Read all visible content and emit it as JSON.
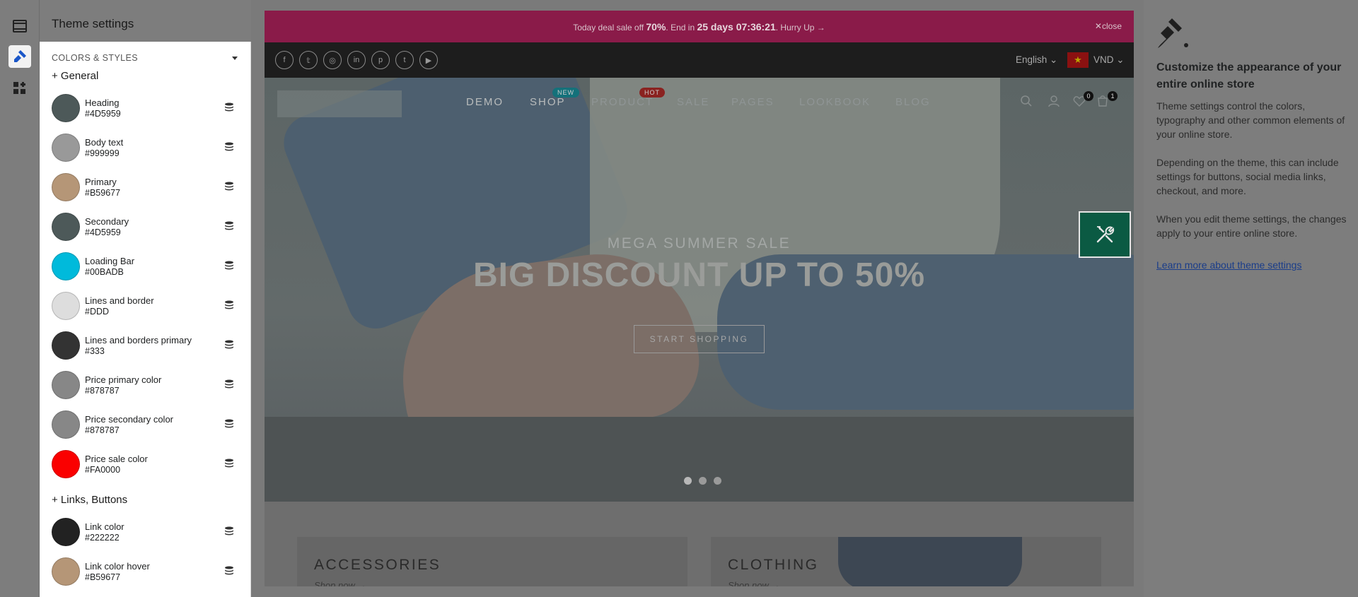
{
  "rail": {
    "items": [
      {
        "name": "sections-icon"
      },
      {
        "name": "theme-settings-icon",
        "active": true
      },
      {
        "name": "apps-icon"
      }
    ]
  },
  "settings": {
    "title": "Theme settings",
    "section_label": "COLORS & STYLES",
    "groups": [
      {
        "label": "+ General",
        "colors": [
          {
            "name": "Heading",
            "hex": "#4D5959",
            "color": "#4D5959"
          },
          {
            "name": "Body text",
            "hex": "#999999",
            "color": "#999999"
          },
          {
            "name": "Primary",
            "hex": "#B59677",
            "color": "#B59677"
          },
          {
            "name": "Secondary",
            "hex": "#4D5959",
            "color": "#4D5959"
          },
          {
            "name": "Loading Bar",
            "hex": "#00BADB",
            "color": "#00BADB"
          },
          {
            "name": "Lines and border",
            "hex": "#DDD",
            "color": "#DDDDDD"
          },
          {
            "name": "Lines and borders primary",
            "hex": "#333",
            "color": "#333333"
          },
          {
            "name": "Price primary color",
            "hex": "#878787",
            "color": "#878787"
          },
          {
            "name": "Price secondary color",
            "hex": "#878787",
            "color": "#878787"
          },
          {
            "name": "Price sale color",
            "hex": "#FA0000",
            "color": "#FA0000"
          }
        ]
      },
      {
        "label": "+ Links, Buttons",
        "colors": [
          {
            "name": "Link color",
            "hex": "#222222",
            "color": "#222222"
          },
          {
            "name": "Link color hover",
            "hex": "#B59677",
            "color": "#B59677"
          }
        ]
      }
    ]
  },
  "preview": {
    "announcement": {
      "prefix": "Today deal sale off ",
      "percent": "70%",
      "middle": ". End in ",
      "countdown": "25 days 07:36:21",
      "suffix": ". Hurry Up →",
      "close_label": "✕close"
    },
    "social_icons": [
      "facebook-icon",
      "twitter-icon",
      "instagram-icon",
      "linkedin-icon",
      "pinterest-icon",
      "tumblr-icon",
      "youtube-icon"
    ],
    "language": "English ⌄",
    "currency": "VND ⌄",
    "flag_symbol": "★",
    "nav": [
      {
        "label": "DEMO"
      },
      {
        "label": "SHOP",
        "badge": "NEW"
      },
      {
        "label": "PRODUCT",
        "badge": "HOT"
      },
      {
        "label": "SALE"
      },
      {
        "label": "PAGES"
      },
      {
        "label": "LOOKBOOK"
      },
      {
        "label": "BLOG"
      }
    ],
    "wishlist_count": "0",
    "cart_count": "1",
    "hero": {
      "subtitle": "MEGA SUMMER SALE",
      "title": "BIG DISCOUNT UP TO 50%",
      "cta": "START SHOPPING",
      "slides": 3,
      "active_slide": 1
    },
    "categories": [
      {
        "title": "ACCESSORIES",
        "link": "Shop now →"
      },
      {
        "title": "CLOTHING",
        "link": "Shop now →"
      }
    ]
  },
  "info": {
    "heading": "Customize the appearance of your entire online store",
    "p1": "Theme settings control the colors, typography and other common elements of your online store.",
    "p2": "Depending on the theme, this can include settings for buttons, social media links, checkout, and more.",
    "p3": "When you edit theme settings, the changes apply to your entire online store.",
    "link": "Learn more about theme settings"
  }
}
